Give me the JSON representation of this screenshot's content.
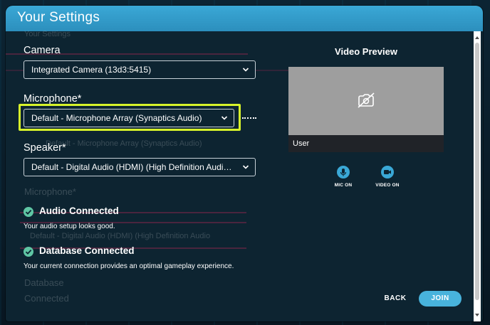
{
  "header": {
    "title": "Your Settings"
  },
  "ghost": {
    "subtitle": "Your Settings",
    "mic_ghost": "Microphone*",
    "mic_value_ghost": "Default - Microphone Array (Synaptics Audio)",
    "speaker_ghost": "Speaker*",
    "speaker_value_ghost": "Default - Digital Audio (HDMI) (High Definition Audio",
    "extra1": "Database",
    "extra2": "Connected"
  },
  "camera": {
    "label": "Camera",
    "value": "Integrated Camera (13d3:5415)"
  },
  "microphone": {
    "label": "Microphone*",
    "value": "Default - Microphone Array (Synaptics Audio)"
  },
  "speaker": {
    "label": "Speaker*",
    "value": "Default - Digital Audio (HDMI) (High Definition Audio ..."
  },
  "status": [
    {
      "title": "Audio Connected",
      "desc": "Your audio setup looks good."
    },
    {
      "title": "Database Connected",
      "desc": "Your current connection provides an optimal gameplay experience."
    }
  ],
  "preview": {
    "title": "Video Preview",
    "user": "User"
  },
  "media": {
    "mic_label": "MIC ON",
    "video_label": "VIDEO ON"
  },
  "actions": {
    "back": "BACK",
    "join": "JOIN"
  },
  "colors": {
    "header": "#3aa8d6",
    "accent": "#48b3dc",
    "highlight": "#d7f22a",
    "success": "#5fc6a4",
    "panel": "#0d2431"
  }
}
